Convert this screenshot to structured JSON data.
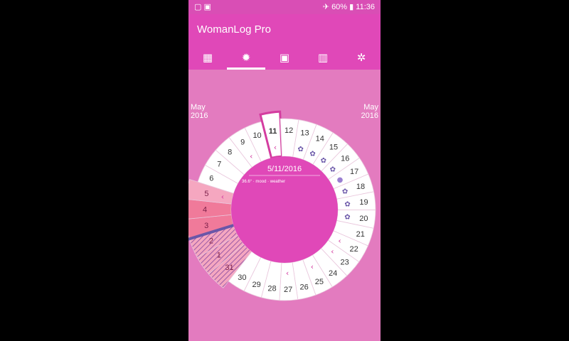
{
  "status_bar": {
    "left_icons": [
      "notification-icon",
      "gallery-icon"
    ],
    "airplane_icon": "airplane-icon",
    "battery_percent": "60%",
    "battery_icon": "battery-icon",
    "time": "11:36"
  },
  "app": {
    "title": "WomanLog Pro"
  },
  "tabs": [
    {
      "name": "calendar",
      "glyph": "▦",
      "active": false
    },
    {
      "name": "cycle",
      "glyph": "✹",
      "active": true
    },
    {
      "name": "notes",
      "glyph": "▣",
      "active": false
    },
    {
      "name": "stats",
      "glyph": "▥",
      "active": false
    },
    {
      "name": "settings",
      "glyph": "✲",
      "active": false
    }
  ],
  "month_labels": {
    "left": {
      "month": "May",
      "year": "2016"
    },
    "right": {
      "month": "May",
      "year": "2016"
    }
  },
  "center": {
    "date": "5/11/2016",
    "notes": "36.6° · mood · weather"
  },
  "days": [
    {
      "label": "31",
      "style": "period-hatched",
      "icon": null
    },
    {
      "label": "1",
      "style": "period-hatched",
      "icon": null
    },
    {
      "label": "2",
      "style": "period-hatched",
      "icon": null
    },
    {
      "label": "3",
      "style": "period",
      "icon": null
    },
    {
      "label": "4",
      "style": "period",
      "icon": null
    },
    {
      "label": "5",
      "style": "period-light",
      "icon": "chevron"
    },
    {
      "label": "6",
      "style": "normal",
      "icon": null
    },
    {
      "label": "7",
      "style": "normal",
      "icon": null
    },
    {
      "label": "8",
      "style": "normal",
      "icon": null
    },
    {
      "label": "9",
      "style": "normal",
      "icon": "chevron"
    },
    {
      "label": "10",
      "style": "normal",
      "icon": null
    },
    {
      "label": "11",
      "style": "selected",
      "icon": "chevron"
    },
    {
      "label": "12",
      "style": "normal",
      "icon": null
    },
    {
      "label": "13",
      "style": "normal",
      "icon": "fertile"
    },
    {
      "label": "14",
      "style": "normal",
      "icon": "fertile"
    },
    {
      "label": "15",
      "style": "normal",
      "icon": "fertile"
    },
    {
      "label": "16",
      "style": "normal",
      "icon": "fertile"
    },
    {
      "label": "17",
      "style": "normal",
      "icon": "ovulation"
    },
    {
      "label": "18",
      "style": "normal",
      "icon": "fertile"
    },
    {
      "label": "19",
      "style": "normal",
      "icon": "fertile"
    },
    {
      "label": "20",
      "style": "normal",
      "icon": "fertile"
    },
    {
      "label": "21",
      "style": "normal",
      "icon": null
    },
    {
      "label": "22",
      "style": "normal",
      "icon": "chevron"
    },
    {
      "label": "23",
      "style": "normal",
      "icon": "chevron"
    },
    {
      "label": "24",
      "style": "normal",
      "icon": null
    },
    {
      "label": "25",
      "style": "normal",
      "icon": "chevron"
    },
    {
      "label": "26",
      "style": "normal",
      "icon": null
    },
    {
      "label": "27",
      "style": "normal",
      "icon": "chevron"
    },
    {
      "label": "28",
      "style": "normal",
      "icon": null
    },
    {
      "label": "29",
      "style": "normal",
      "icon": null
    },
    {
      "label": "30",
      "style": "normal",
      "icon": null
    }
  ],
  "colors": {
    "app_bar": "#e048b8",
    "status_bar": "#d94eb5",
    "background": "#e37bbf",
    "wheel_center": "#e048b8",
    "period": "#f07a9a",
    "period_light": "#f5a7c0",
    "hatch": "#9a5aa6",
    "marker": "#6a56a8",
    "ring": "#ffffff",
    "accent": "#d43da0"
  }
}
